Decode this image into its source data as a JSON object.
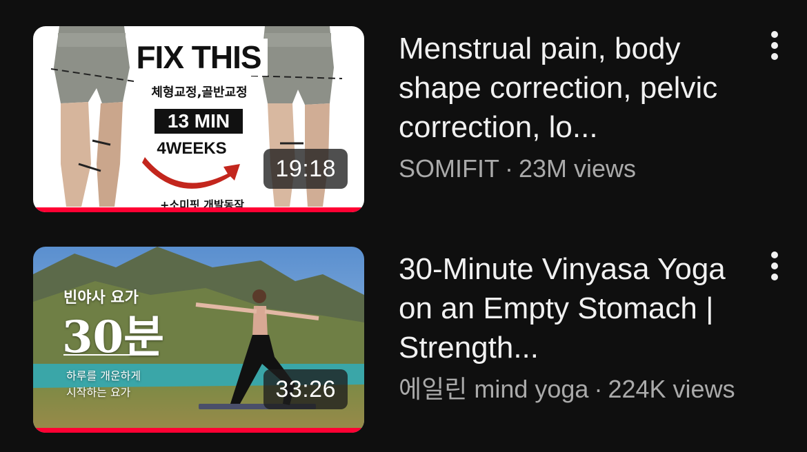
{
  "videos": [
    {
      "title": "Menstrual pain, body shape correction, pelvic correction, lo...",
      "channel": "SOMIFIT",
      "views": "23M views",
      "duration": "19:18",
      "watch_progress": 1.0,
      "thumbnail": {
        "fix": "FIX THIS",
        "korean": "체형교정,골반교정",
        "min": "13 MIN",
        "weeks": "4WEEKS",
        "bottom": "+소미핏 개발동작"
      }
    },
    {
      "title": "30-Minute Vinyasa Yoga on an Empty Stomach | Strength...",
      "channel": "에일린 mind yoga",
      "views": "224K views",
      "duration": "33:26",
      "watch_progress": 1.0,
      "thumbnail": {
        "line1": "빈야사 요가",
        "line2": "30분",
        "line3": "하루를 개운하게",
        "line4": "시작하는 요가"
      }
    }
  ],
  "separator": "·",
  "icons": {
    "more": "more-vert-icon"
  },
  "colors": {
    "background": "#0f0f0f",
    "progress": "#ff0033",
    "title": "#f1f1f1",
    "subtitle": "#aaaaaa"
  }
}
